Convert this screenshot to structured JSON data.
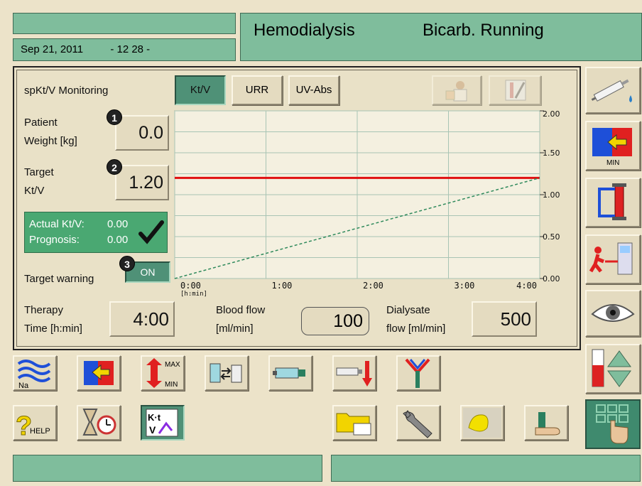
{
  "header": {
    "date": "Sep 21, 2011",
    "time": "- 12 28 -",
    "mode": "Hemodialysis",
    "status": "Bicarb. Running"
  },
  "panel": {
    "title": "spKt/V Monitoring",
    "tabs": [
      {
        "label": "Kt/V",
        "active": true
      },
      {
        "label": "URR",
        "active": false
      },
      {
        "label": "UV-Abs",
        "active": false
      }
    ],
    "patient_weight": {
      "label_line1": "Patient",
      "label_line2": "Weight [kg]",
      "value": "0.0",
      "badge": "1"
    },
    "target_ktv": {
      "label_line1": "Target",
      "label_line2": "Kt/V",
      "value": "1.20",
      "badge": "2"
    },
    "actual": {
      "label": "Actual Kt/V:",
      "value": "0.00"
    },
    "prognosis": {
      "label": "Prognosis:",
      "value": "0.00"
    },
    "target_warning": {
      "label": "Target warning",
      "value": "ON",
      "badge": "3"
    },
    "therapy_time": {
      "label_line1": "Therapy",
      "label_line2": "Time [h:min]",
      "value": "4:00"
    },
    "blood_flow": {
      "label_line1": "Blood flow",
      "label_line2": "[ml/min]",
      "value": "100"
    },
    "dialysate_flow": {
      "label_line1": "Dialysate",
      "label_line2": "flow [ml/min]",
      "value": "500"
    }
  },
  "chart_data": {
    "type": "line",
    "x_ticks": [
      "0:00",
      "1:00",
      "2:00",
      "3:00",
      "4:00"
    ],
    "x_unit": "[h:min]",
    "y_ticks": [
      "0.00",
      "0.50",
      "1.00",
      "1.50",
      "2.00"
    ],
    "xlim": [
      0,
      4
    ],
    "ylim": [
      0,
      2
    ],
    "grid": true,
    "series": [
      {
        "style": "solid",
        "color": "#e01010",
        "x": [
          0,
          4
        ],
        "y": [
          1.2,
          1.2
        ]
      },
      {
        "style": "dashed",
        "color": "#2f8a5c",
        "x": [
          0,
          4
        ],
        "y": [
          0.0,
          1.2
        ]
      }
    ]
  },
  "colors": {
    "status_green": "#7fbd9c",
    "selected_tab": "#4f9177",
    "target_line": "#e01010",
    "prognosis_line": "#2f8a5c",
    "background": "#ece3c9"
  },
  "icons": {
    "right_column": [
      "syringe-drop-icon",
      "min-uf-icon",
      "filter-bypass-icon",
      "patient-disconnect-icon",
      "eye-icon",
      "level-adjust-icon"
    ],
    "bottom_row1": [
      "sodium-profile-icon",
      "uf-profile-icon",
      "max-min-limits-icon",
      "fluid-bolus-icon",
      "heparin-syringe-icon",
      "syringe-arterial-icon",
      "single-needle-icon"
    ],
    "bottom_row2": [
      "help-icon",
      "timer-icon",
      "ktv-clipboard-icon",
      "folder-card-icon",
      "wrench-icon",
      "cleaning-icon",
      "blood-pressure-cuff-icon",
      "keypad-hand-icon"
    ],
    "help_label": "HELP",
    "min_label": "MIN",
    "max_label": "MAX",
    "na_label": "Na",
    "ktv_k": "K·t",
    "ktv_v": "V"
  }
}
